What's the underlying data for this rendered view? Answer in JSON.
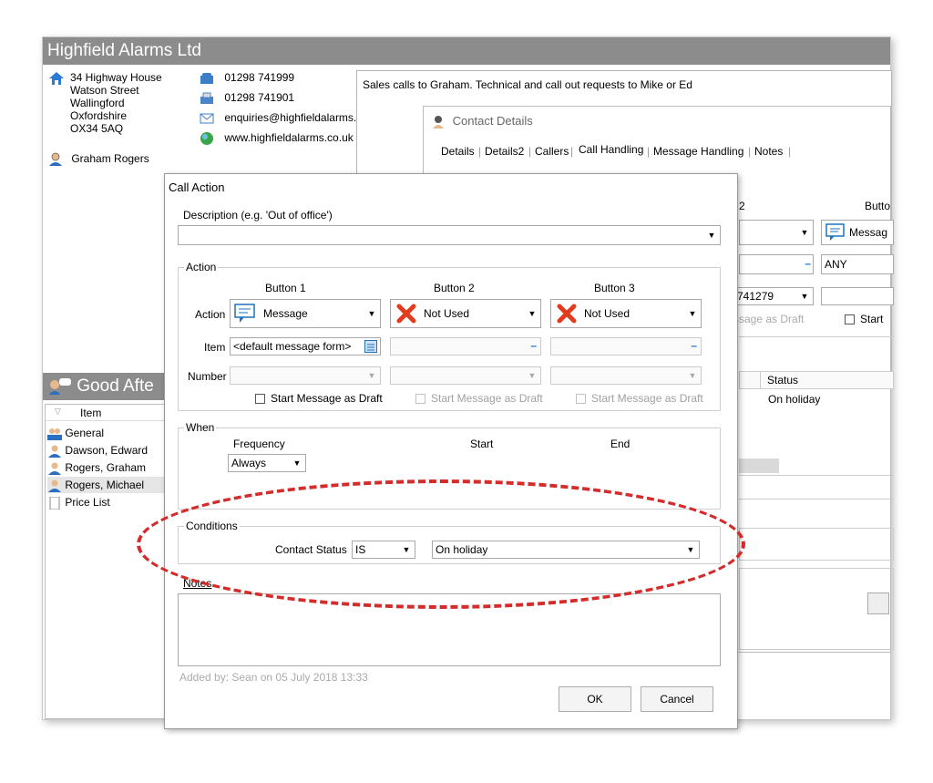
{
  "main_window": {
    "title": "Highfield Alarms Ltd",
    "address": [
      "34 Highway House",
      "Watson Street",
      "Wallingford",
      "Oxfordshire",
      "OX34 5AQ"
    ],
    "contact_name": "Graham Rogers",
    "phone": "01298 741999",
    "fax": "01298 741901",
    "email": "enquiries@highfieldalarms.c",
    "website": "www.highfieldalarms.co.uk",
    "notes_text": "Sales calls to Graham. Technical and call out requests to Mike or Ed",
    "greeting": "Good Afte",
    "list_header": "Item",
    "list_items": [
      "General",
      "Dawson, Edward",
      "Rogers, Graham",
      "Rogers, Michael",
      "Price List"
    ]
  },
  "contact_details": {
    "title": "Contact Details",
    "tabs": [
      "Details",
      "Details2",
      "Callers",
      "Call Handling",
      "Message Handling",
      "Notes"
    ],
    "button_col_label_partial": "Butto",
    "col2_label_partial": "2",
    "message_label_partial": "Messag",
    "any_value": "ANY",
    "number_partial": "741279",
    "draft_partial": "ssage as Draft",
    "start_partial": "Start",
    "status_header": "Status",
    "status_value": "On holiday"
  },
  "call_action": {
    "title": "Call Action",
    "description_label": "Description (e.g. 'Out of office')",
    "description_value": "",
    "action_group_label": "Action",
    "button_headers": [
      "Button 1",
      "Button 2",
      "Button 3"
    ],
    "action_label": "Action",
    "item_label": "Item",
    "number_label": "Number",
    "action_values": [
      "Message",
      "Not Used",
      "Not Used"
    ],
    "item_value_1": "<default message form>",
    "start_draft": "Start Message as Draft",
    "when_group_label": "When",
    "frequency_label": "Frequency",
    "frequency_value": "Always",
    "start_label": "Start",
    "end_label": "End",
    "conditions_group_label": "Conditions",
    "contact_status_label": "Contact Status",
    "operator_value": "IS",
    "status_value": "On holiday",
    "notes_label": "Notes",
    "added_by": "Added by: Sean on 05 July 2018 13:33",
    "ok_label": "OK",
    "cancel_label": "Cancel"
  },
  "colors": {
    "title_bar": "#8c8c8c",
    "highlight": "#d42b2b",
    "message_icon": "#1e73be",
    "not_used_icon": "#e23b1e"
  }
}
